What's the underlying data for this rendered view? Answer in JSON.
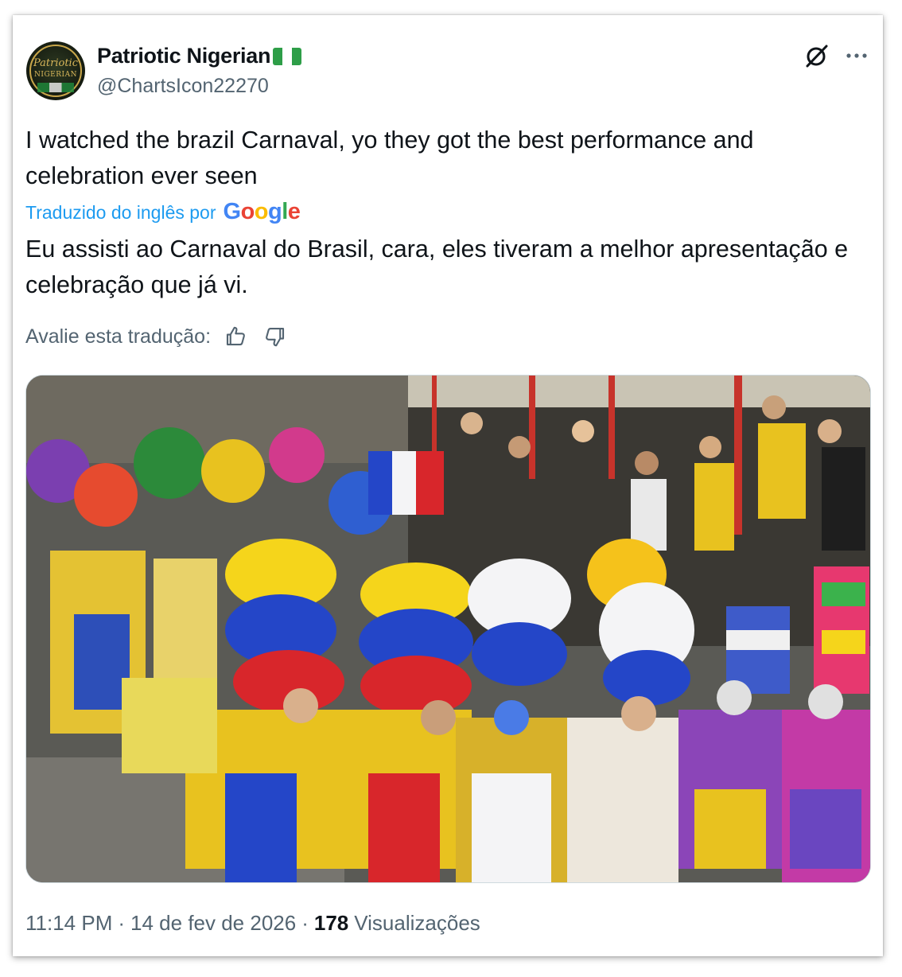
{
  "user": {
    "display_name": "Patriotic Nigerian",
    "handle": "@ChartsIcon22270",
    "avatar_text_line1": "Patriotic",
    "avatar_text_line2": "NIGERIAN"
  },
  "tweet": {
    "text_original": "I watched the brazil Carnaval, yo they got the best performance and celebration ever seen",
    "translated_label": "Traduzido do inglês por",
    "translator": "Google",
    "text_translated": "Eu assisti ao Carnaval do Brasil, cara, eles tiveram a melhor apresentação e celebração que já vi.",
    "rate_label": "Avalie esta tradução:",
    "image_alt": "Carnival dancers in colorful feathered costumes and hats parading before a crowd"
  },
  "meta": {
    "time": "11:14 PM",
    "date": "14 de fev de 2026",
    "separator": "·",
    "views_count": "178",
    "views_label": "Visualizações"
  },
  "icons": {
    "grok": "grok-icon",
    "more": "more-icon",
    "thumbs_up": "thumbs-up-icon",
    "thumbs_down": "thumbs-down-icon"
  },
  "colors": {
    "link_blue": "#1d9bf0",
    "secondary_text": "#536471",
    "primary_text": "#0f1419",
    "nigeria_green": "#2e9e48"
  }
}
